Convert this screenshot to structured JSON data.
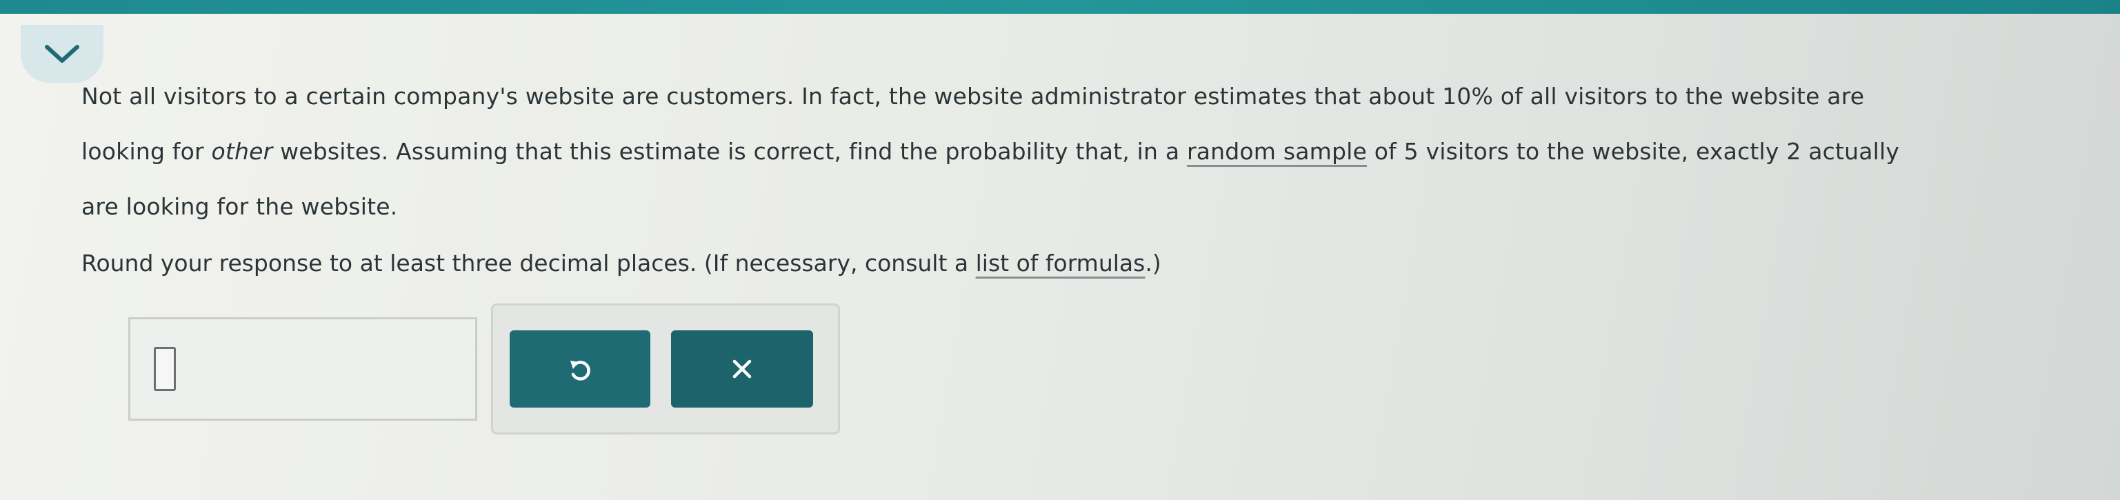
{
  "question": {
    "line1": "Not all visitors to a certain company's website are customers. In fact, the website administrator estimates that about 10% of all visitors to the website are",
    "line2_pre": "looking for ",
    "line2_italic": "other",
    "line2_mid": " websites. Assuming that this estimate is correct, find the probability that, in a ",
    "line2_link": "random sample",
    "line2_post": " of 5 visitors to the website, exactly 2 actually",
    "line3": "are looking for the website."
  },
  "instruction": {
    "pre": "Round your response to at least three decimal places. (If necessary, consult a ",
    "link": "list of formulas",
    "post": ".)"
  },
  "answer": {
    "value": ""
  },
  "icons": {
    "toggle": "chevron-down-icon",
    "undo": "undo-icon",
    "clear": "close-icon"
  },
  "colors": {
    "top_bar": "#1d8a8f",
    "button": "#1f6b73",
    "text": "#2b3538"
  }
}
